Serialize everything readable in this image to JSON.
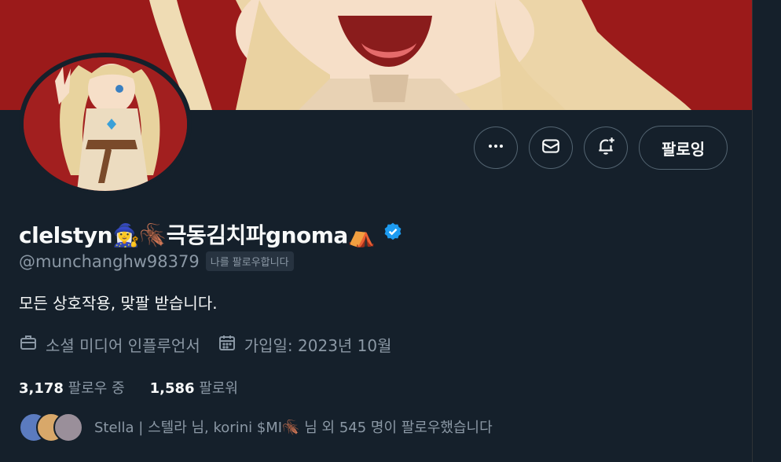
{
  "profile": {
    "display_name": "clelstyn🧙‍♀️🪳극동김치파gnoma⛺",
    "handle": "@munchanghw98379",
    "follows_you": "나를 팔로우합니다",
    "bio": "모든 상호작용, 맞팔 받습니다.",
    "category": "소셜 미디어 인플루언서",
    "joined": "가입일: 2023년 10월",
    "following_count": "3,178",
    "following_label": "팔로우 중",
    "followers_count": "1,586",
    "followers_label": "팔로워",
    "known_followers": "Stella | 스텔라 님, korini $MI🪳 님 외 545 명이 팔로우했습니다"
  },
  "actions": {
    "more": "more-icon",
    "message": "envelope-icon",
    "notify": "bell-plus-icon",
    "follow_label": "팔로잉"
  },
  "colors": {
    "background": "#15202b",
    "banner": "#9b1a1a",
    "verified": "#1d9bf0",
    "muted_text": "#8b98a5"
  }
}
